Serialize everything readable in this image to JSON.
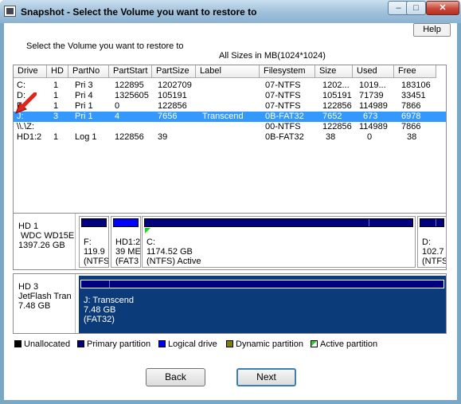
{
  "window": {
    "title": "Snapshot - Select the Volume you want to restore to",
    "minimize_glyph": "–",
    "maximize_glyph": "□",
    "close_glyph": "✕"
  },
  "help_label": "Help",
  "instruction": "Select the Volume you want to restore to",
  "sizes_note": "All Sizes in MB(1024*1024)",
  "table": {
    "columns": [
      "Drive",
      "HD",
      "PartNo",
      "PartStart",
      "PartSize",
      "Label",
      "Filesystem",
      "Size",
      "Used",
      "Free"
    ],
    "rows": [
      [
        "C:",
        "1",
        "Pri 3",
        "122895",
        "1202709",
        "",
        "07-NTFS",
        "1202...",
        "1019...",
        "183106"
      ],
      [
        "D:",
        "1",
        "Pri 4",
        "1325605",
        "105191",
        "",
        "07-NTFS",
        "105191",
        "71739",
        "33451"
      ],
      [
        "F:",
        "1",
        "Pri 1",
        "0",
        "122856",
        "",
        "07-NTFS",
        "122856",
        "114989",
        "7866"
      ],
      [
        "J:",
        "3",
        "Pri 1",
        "4",
        "7656",
        "Transcend",
        "0B-FAT32",
        "7652",
        "673",
        "6978"
      ],
      [
        "\\\\.\\Z:",
        "",
        "",
        "",
        "",
        "",
        "00-NTFS",
        "122856",
        "114989",
        "7866"
      ],
      [
        "HD1:2",
        "1",
        "Log 1",
        "122856",
        "39",
        "",
        "0B-FAT32",
        "38",
        "0",
        "38"
      ]
    ],
    "selected_row": 3
  },
  "disks": [
    {
      "name": "HD 1",
      "model": "WDC WD15E",
      "size": "1397.26 GB",
      "partitions": [
        {
          "l1": "F:",
          "l2": "119.9",
          "l3": "(NTFS"
        },
        {
          "l1": "HD1:2",
          "l2": "39 ME",
          "l3": "(FAT3"
        },
        {
          "l1": "C:",
          "l2": "1174.52 GB",
          "l3": "(NTFS) Active"
        },
        {
          "l1": "D:",
          "l2": "102.7",
          "l3": "(NTFS"
        }
      ]
    },
    {
      "name": "HD 3",
      "model": "JetFlash Tran",
      "size": "7.48 GB",
      "partitions": [
        {
          "l1": "J: Transcend",
          "l2": "7.48 GB",
          "l3": "(FAT32)"
        }
      ]
    }
  ],
  "legend": [
    {
      "label": "Unallocated",
      "color": "#000000"
    },
    {
      "label": "Primary partition",
      "color": "#00007f"
    },
    {
      "label": "Logical drive",
      "color": "#0000ff"
    },
    {
      "label": "Dynamic partition",
      "color": "#808000"
    },
    {
      "label": "Active partition",
      "color": "#2ad02a"
    }
  ],
  "buttons": {
    "back": "Back",
    "next": "Next"
  }
}
